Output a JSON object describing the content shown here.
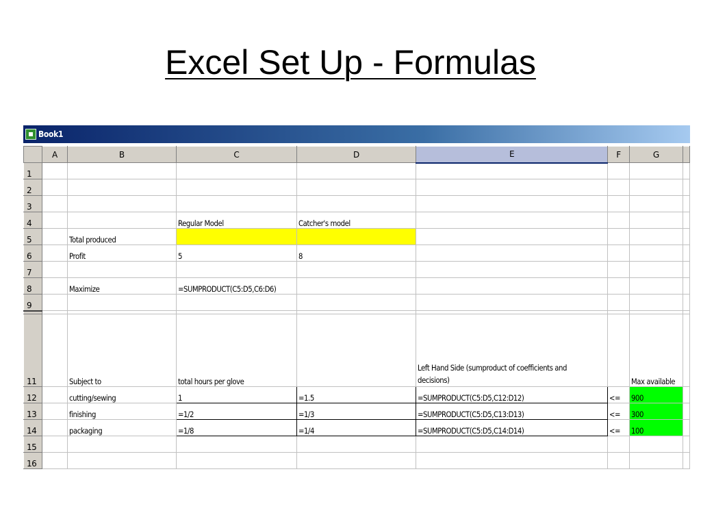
{
  "slide": {
    "title": "Excel Set Up - Formulas"
  },
  "window": {
    "title": "Book1"
  },
  "columns": [
    "A",
    "B",
    "C",
    "D",
    "E",
    "F",
    "G"
  ],
  "active_column": "E",
  "rows": {
    "r1": {
      "num": "1"
    },
    "r2": {
      "num": "2"
    },
    "r3": {
      "num": "3"
    },
    "r4": {
      "num": "4",
      "C": "Regular Model",
      "D": "Catcher's model"
    },
    "r5": {
      "num": "5",
      "B": "Total produced"
    },
    "r6": {
      "num": "6",
      "B": "Profit",
      "C": "5",
      "D": "8"
    },
    "r7": {
      "num": "7"
    },
    "r8": {
      "num": "8",
      "B": "Maximize",
      "C": "=SUMPRODUCT(C5:D5,C6:D6)"
    },
    "r9": {
      "num": "9"
    },
    "r11": {
      "num": "11",
      "B": "Subject to",
      "C": "total hours per glove",
      "E": "Left Hand Side (sumproduct of coefficients and decisions)",
      "G": "Max available"
    },
    "r12": {
      "num": "12",
      "B": "cutting/sewing",
      "C": "1",
      "D": "=1.5",
      "E": "=SUMPRODUCT(C5:D5,C12:D12)",
      "F": "<=",
      "G": "900"
    },
    "r13": {
      "num": "13",
      "B": "finishing",
      "C": "=1/2",
      "D": "=1/3",
      "E": "=SUMPRODUCT(C5:D5,C13:D13)",
      "F": "<=",
      "G": "300"
    },
    "r14": {
      "num": "14",
      "B": "packaging",
      "C": "=1/8",
      "D": "=1/4",
      "E": "=SUMPRODUCT(C5:D5,C14:D14)",
      "F": "<=",
      "G": "100"
    },
    "r15": {
      "num": "15"
    },
    "r16": {
      "num": "16"
    }
  },
  "colors": {
    "decision_cells": "#ffff00",
    "constraint_limits": "#00ff00",
    "titlebar": "#0a246a"
  }
}
